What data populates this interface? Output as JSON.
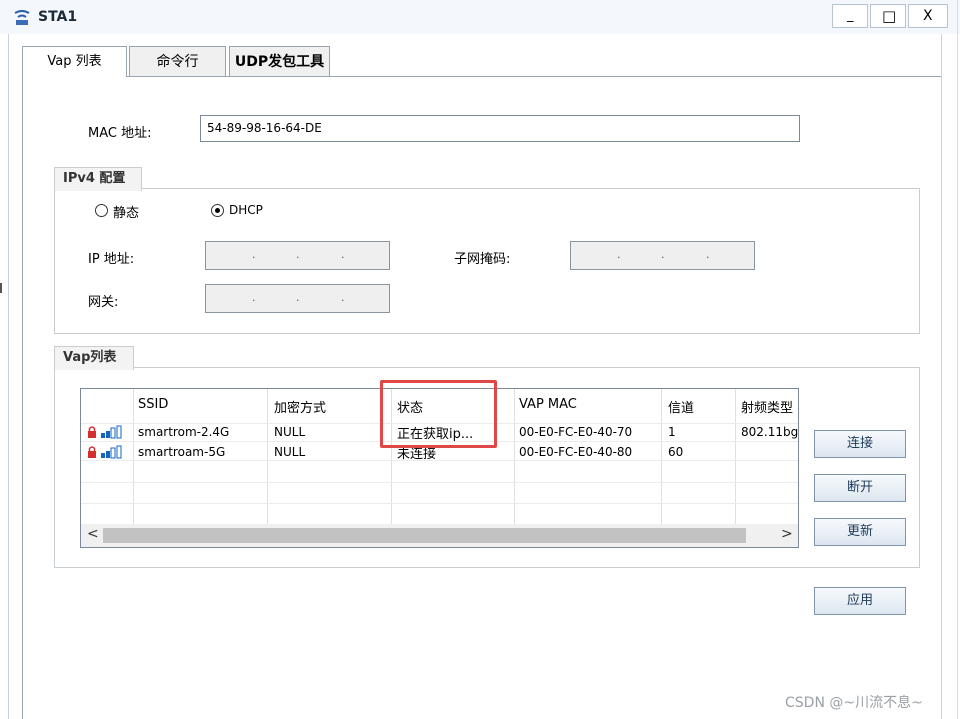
{
  "window": {
    "title": "STA1",
    "minimize": "_",
    "maximize": "□",
    "close": "X"
  },
  "tabs": [
    "Vap 列表",
    "命令行",
    "UDP发包工具"
  ],
  "mac": {
    "label": "MAC 地址:",
    "value": "54-89-98-16-64-DE"
  },
  "ipv4": {
    "group_title": "IPv4 配置",
    "radio_static": "静态",
    "radio_dhcp": "DHCP",
    "selected": "DHCP",
    "ip_label": "IP 地址:",
    "mask_label": "子网掩码:",
    "gateway_label": "网关:",
    "ip_dots": ".",
    "mask_dots": ".",
    "gw_dots": "."
  },
  "vap": {
    "group_title": "Vap列表",
    "columns": [
      "SSID",
      "加密方式",
      "状态",
      "VAP MAC",
      "信道",
      "射频类型"
    ],
    "rows": [
      {
        "ssid": "smartrom-2.4G",
        "encryption": "NULL",
        "status": "正在获取ip...",
        "vap_mac": "00-E0-FC-E0-40-70",
        "channel": "1",
        "radio": "802.11bg"
      },
      {
        "ssid": "smartroam-5G",
        "encryption": "NULL",
        "status": "未连接",
        "vap_mac": "00-E0-FC-E0-40-80",
        "channel": "60",
        "radio": ""
      }
    ],
    "scroll_left": "<",
    "scroll_right": ">"
  },
  "buttons": {
    "connect": "连接",
    "disconnect": "断开",
    "refresh": "更新",
    "apply": "应用"
  },
  "watermark": "CSDN @~川流不息~",
  "colors": {
    "highlight": "#e04848",
    "signal_blue": "#1565c0",
    "lock_red": "#d32f2f"
  }
}
